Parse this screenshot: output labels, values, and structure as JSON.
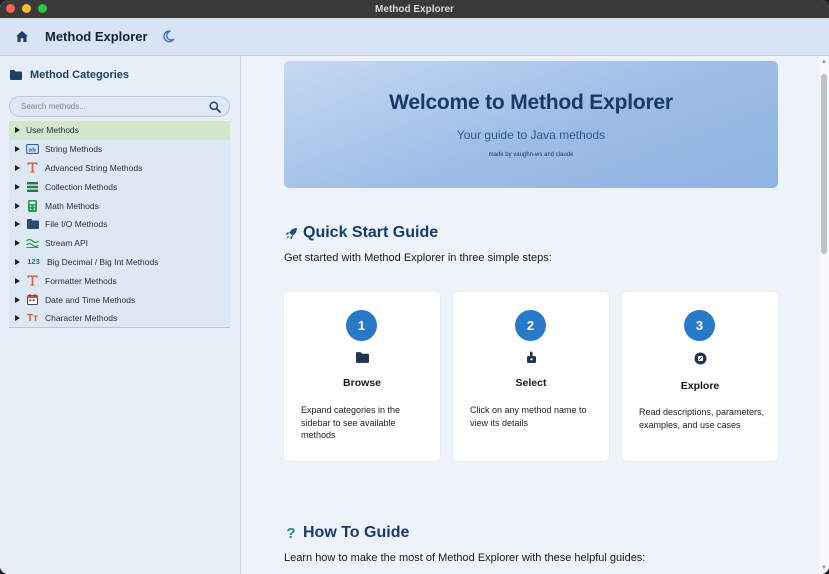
{
  "window": {
    "title": "Method Explorer"
  },
  "header": {
    "title": "Method Explorer",
    "home_icon": "home-icon",
    "theme_icon": "moon-icon"
  },
  "sidebar": {
    "heading": "Method Categories",
    "search_placeholder": "Search methods...",
    "items": [
      {
        "label": "User Methods",
        "icon": "none",
        "selected": true
      },
      {
        "label": "String Methods",
        "icon": "string-icon"
      },
      {
        "label": "Advanced String Methods",
        "icon": "text-t-icon"
      },
      {
        "label": "Collection Methods",
        "icon": "list-icon"
      },
      {
        "label": "Math Methods",
        "icon": "calculator-icon"
      },
      {
        "label": "File I/O Methods",
        "icon": "folder-icon"
      },
      {
        "label": "Stream API",
        "icon": "stream-icon"
      },
      {
        "label": "Big Decimal / Big Int Methods",
        "icon": "123-icon",
        "icon_text": "123"
      },
      {
        "label": "Formatter Methods",
        "icon": "text-t-icon"
      },
      {
        "label": "Date and Time Methods",
        "icon": "calendar-icon"
      },
      {
        "label": "Character Methods",
        "icon": "character-icon",
        "icon_text": "Tт"
      }
    ]
  },
  "hero": {
    "title": "Welcome to Method Explorer",
    "subtitle": "Your guide to Java methods",
    "credit": "made by vaughn-ws and claude"
  },
  "quick_start": {
    "title": "Quick Start Guide",
    "intro": "Get started with Method Explorer in three simple steps:",
    "steps": [
      {
        "number": "1",
        "title": "Browse",
        "icon": "folder-icon",
        "desc": "Expand categories in the sidebar to see available methods"
      },
      {
        "number": "2",
        "title": "Select",
        "icon": "pointer-icon",
        "desc": "Click on any method name to view its details"
      },
      {
        "number": "3",
        "title": "Explore",
        "icon": "explore-icon",
        "desc": "Read descriptions, parameters, examples, and use cases"
      }
    ]
  },
  "how_to": {
    "title": "How To Guide",
    "intro": "Learn how to make the most of Method Explorer with these helpful guides:"
  },
  "colors": {
    "accent": "#2979c9",
    "heading": "#173b6b",
    "selected_row": "#d1e6cd",
    "hero_start": "#c6d9f2",
    "hero_end": "#8fb3e1"
  }
}
